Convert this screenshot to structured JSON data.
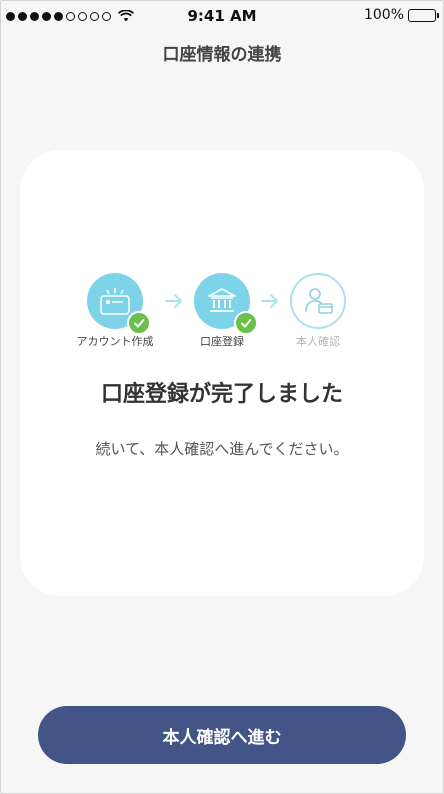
{
  "status_bar": {
    "time": "9:41 AM",
    "battery": "100%",
    "signal_dots_filled": 5,
    "signal_dots_total": 9
  },
  "header": {
    "title": "口座情報の連携"
  },
  "steps": [
    {
      "label": "アカウント作成",
      "icon": "credit-card-icon",
      "state": "done"
    },
    {
      "label": "口座登録",
      "icon": "bank-icon",
      "state": "done"
    },
    {
      "label": "本人確認",
      "icon": "person-id-icon",
      "state": "todo"
    }
  ],
  "message": {
    "headline": "口座登録が完了しました",
    "body": "続いて、本人確認へ進んでください。"
  },
  "action": {
    "label": "本人確認へ進む"
  },
  "colors": {
    "accent": "#7dd4e8",
    "check": "#6ac04a",
    "button": "#435487",
    "muted": "#b5b5b5"
  }
}
